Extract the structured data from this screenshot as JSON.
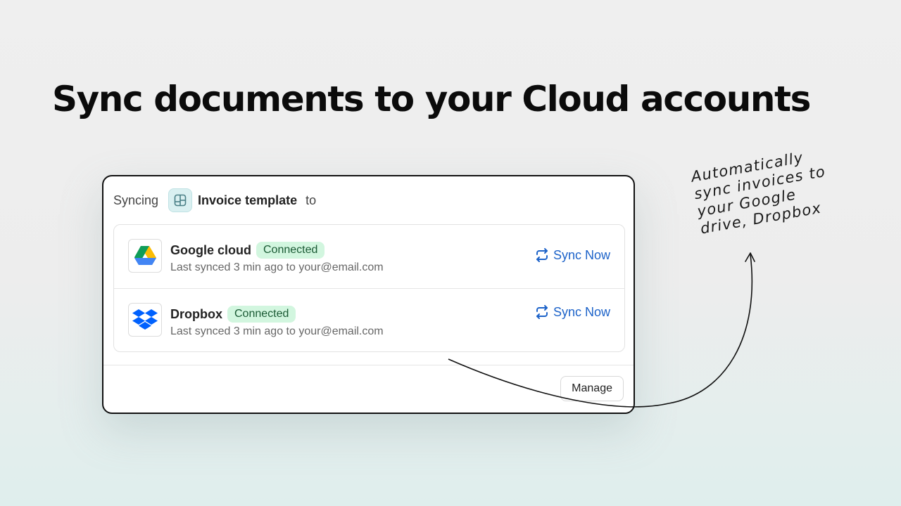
{
  "headline": "Sync documents to your Cloud accounts",
  "panel": {
    "syncing_label": "Syncing",
    "template_name": "Invoice template",
    "to_label": "to",
    "accounts": [
      {
        "name": "Google cloud",
        "status": "Connected",
        "subtitle": "Last synced 3 min ago to your@email.com",
        "action": "Sync Now",
        "icon": "google-drive-icon"
      },
      {
        "name": "Dropbox",
        "status": "Connected",
        "subtitle": "Last synced 3 min ago to your@email.com",
        "action": "Sync Now",
        "icon": "dropbox-icon"
      }
    ],
    "manage_label": "Manage"
  },
  "annotation": {
    "lines": [
      "Automatically",
      "sync invoices to",
      "your Google",
      "drive, Dropbox"
    ]
  },
  "colors": {
    "accent_blue": "#1d63c9",
    "badge_bg": "#d2f6df",
    "badge_text": "#1a5a34"
  }
}
